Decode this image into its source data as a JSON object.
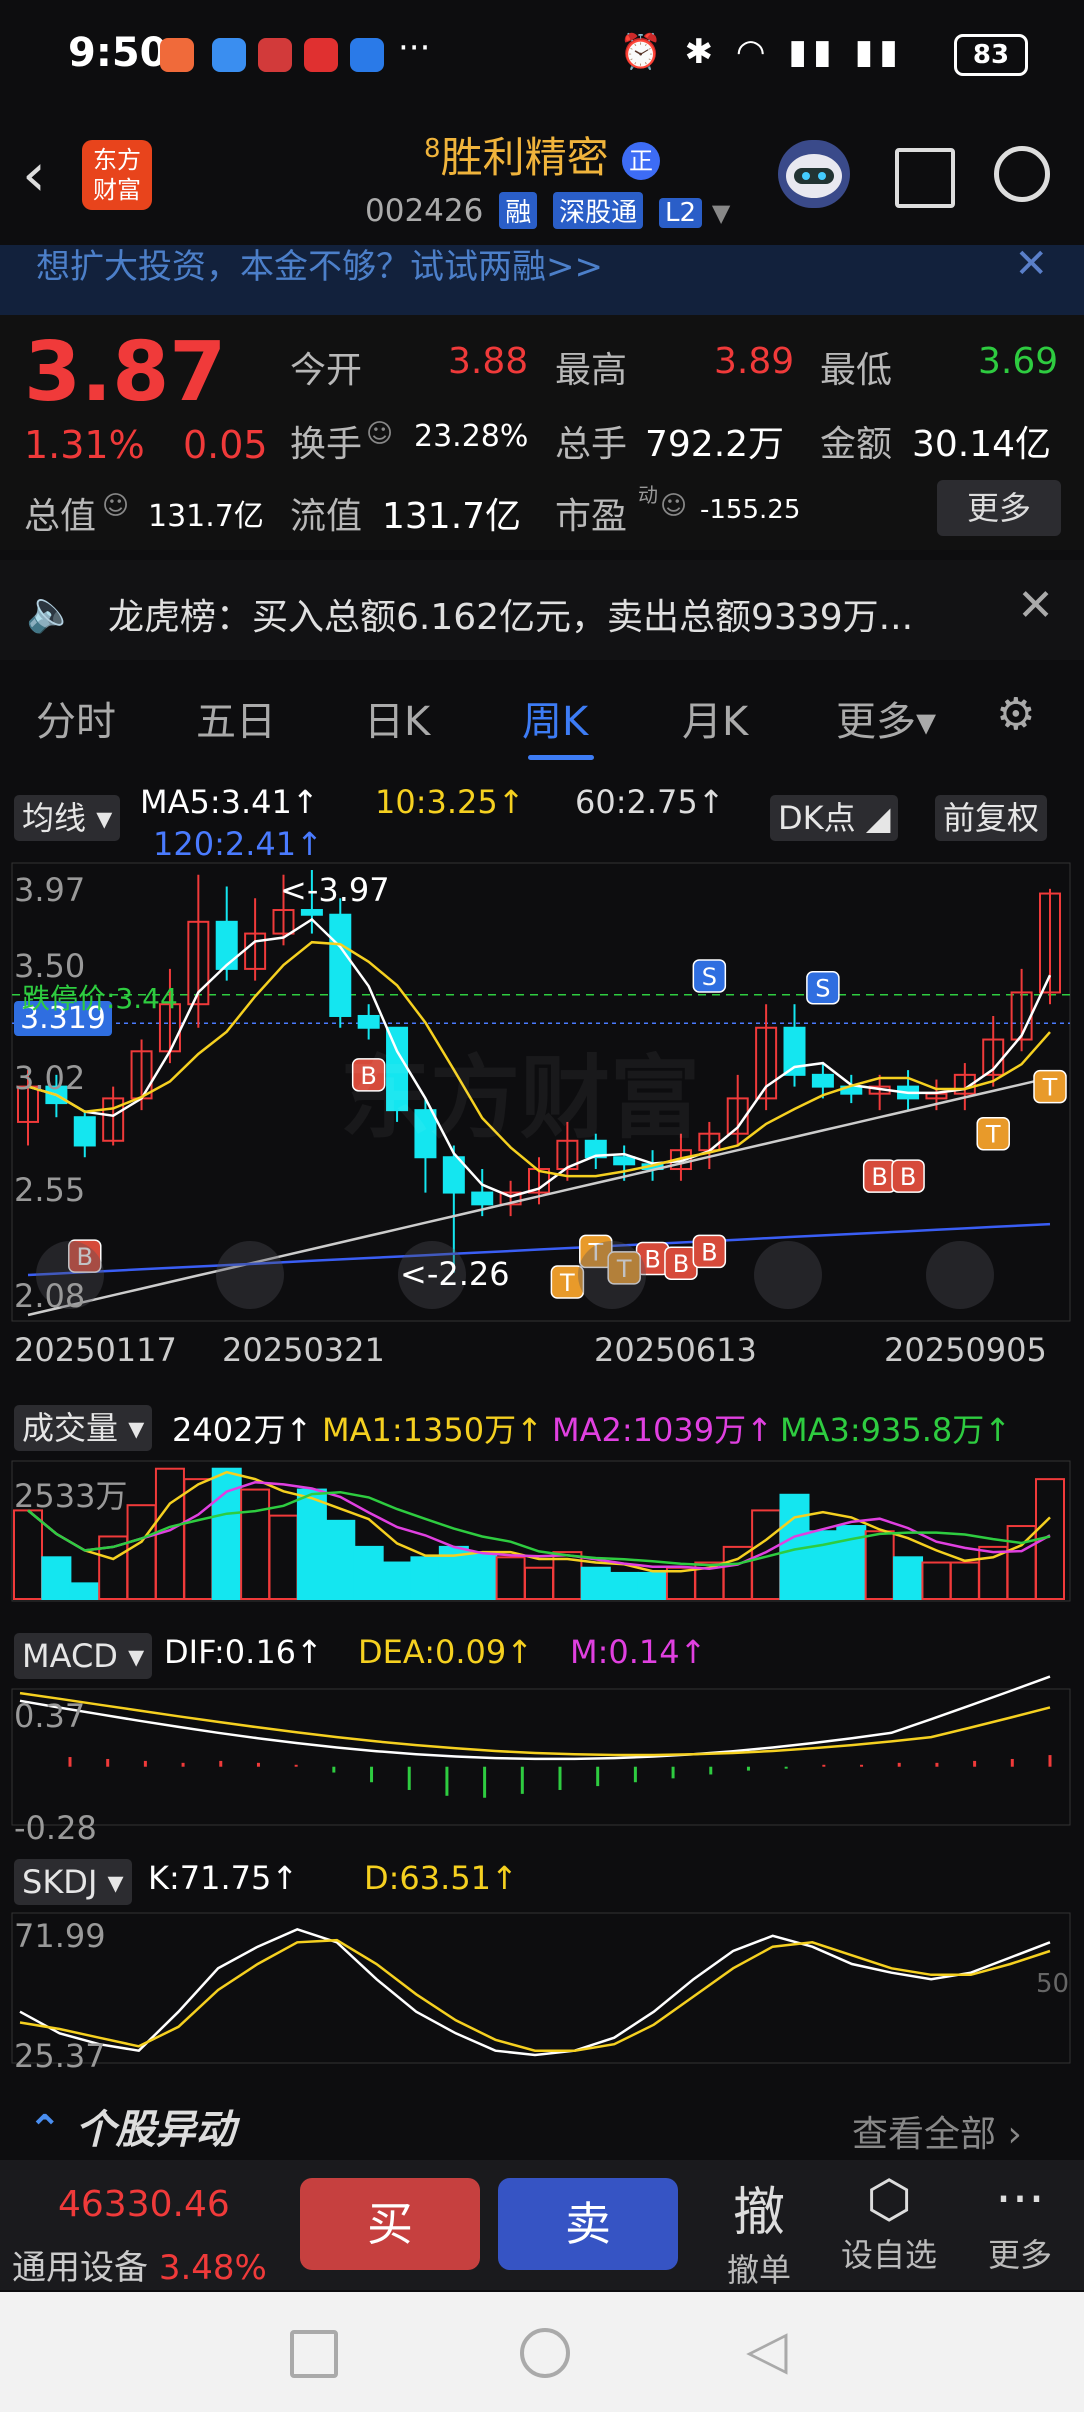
{
  "status_bar": {
    "time": "9:50",
    "dots": "···",
    "battery": "83"
  },
  "header": {
    "back": "‹",
    "logo_line1": "东方",
    "logo_line2": "财富",
    "level": "8",
    "stock_name": "胜利精密",
    "name_badge": "正",
    "stock_code": "002426",
    "tags": [
      "融",
      "深股通",
      "L2"
    ]
  },
  "banner": {
    "text": "想扩大投资，本金不够？试试两融>>",
    "close": "✕"
  },
  "quote": {
    "price": "3.87",
    "change_pct": "1.31%",
    "change": "0.05",
    "open_label": "今开",
    "open": "3.88",
    "high_label": "最高",
    "high": "3.89",
    "low_label": "最低",
    "low": "3.69",
    "turnover_label": "换手",
    "turnover": "23.28%",
    "volume_label": "总手",
    "volume": "792.2万",
    "amount_label": "金额",
    "amount": "30.14亿",
    "mktcap_label": "总值",
    "mktcap": "131.7亿",
    "float_label": "流值",
    "float": "131.7亿",
    "pe_label": "市盈",
    "pe_sup": "动",
    "pe": "-155.25",
    "more": "更多"
  },
  "dragon_tiger": {
    "text": "龙虎榜：买入总额6.162亿元，卖出总额9339万...",
    "close": "✕"
  },
  "tabs": [
    {
      "label": "分时"
    },
    {
      "label": "五日"
    },
    {
      "label": "日K"
    },
    {
      "label": "周K"
    },
    {
      "label": "月K"
    },
    {
      "label": "更多▾"
    }
  ],
  "kline": {
    "indicator_btn": "均线",
    "ma5": "MA5:3.41↑",
    "ma10": "10:3.25↑",
    "ma60": "60:2.75↑",
    "ma120": "120:2.41↑",
    "dk_btn": "DK点",
    "adj_btn": "前复权",
    "y_labels": [
      "3.97",
      "3.50",
      "3.02",
      "2.55",
      "2.08"
    ],
    "current_price_tag": "3.319",
    "limit_label": "跌停价:3.44",
    "high_mark": "<-3.97",
    "low_mark": "<-2.26",
    "x_labels": [
      "20250117",
      "20250321",
      "20250613",
      "20250905"
    ],
    "watermark": "东方财富"
  },
  "volume": {
    "indicator_btn": "成交量",
    "vol": "2402万↑",
    "ma1": "MA1:1350万↑",
    "ma2": "MA2:1039万↑",
    "ma3": "MA3:935.8万↑",
    "y_top": "2533万"
  },
  "macd": {
    "indicator_btn": "MACD",
    "dif": "DIF:0.16↑",
    "dea": "DEA:0.09↑",
    "m": "M:0.14↑",
    "y_top": "0.37",
    "y_bottom": "-0.28"
  },
  "skdj": {
    "indicator_btn": "SKDJ",
    "k": "K:71.75↑",
    "d": "D:63.51↑",
    "y_top": "71.99",
    "y_bottom": "25.37",
    "mid": "50"
  },
  "anomaly": {
    "title": "个股异动",
    "view_all": "查看全部 ›"
  },
  "bottom": {
    "index_value": "46330.46",
    "sector": "通用设备",
    "sector_pct": "3.48%",
    "buy": "买",
    "sell": "卖",
    "cancel_big": "撤",
    "cancel": "撤单",
    "watch": "设自选",
    "more": "更多"
  },
  "chart_data": {
    "type": "candlestick",
    "note_x_labels": [
      "20250117",
      "20250321",
      "20250613",
      "20250905"
    ],
    "y_range": [
      2.08,
      3.97
    ],
    "candles": [
      [
        2.9,
        3.05,
        2.8,
        3.12
      ],
      [
        3.05,
        2.98,
        2.92,
        3.1
      ],
      [
        2.92,
        2.8,
        2.75,
        2.95
      ],
      [
        2.82,
        3.0,
        2.8,
        3.05
      ],
      [
        3.0,
        3.2,
        2.95,
        3.25
      ],
      [
        3.2,
        3.4,
        3.15,
        3.55
      ],
      [
        3.4,
        3.75,
        3.3,
        3.95
      ],
      [
        3.75,
        3.55,
        3.5,
        3.9
      ],
      [
        3.55,
        3.7,
        3.5,
        3.85
      ],
      [
        3.7,
        3.8,
        3.65,
        3.95
      ],
      [
        3.8,
        3.78,
        3.7,
        3.97
      ],
      [
        3.78,
        3.35,
        3.3,
        3.85
      ],
      [
        3.35,
        3.3,
        3.25,
        3.4
      ],
      [
        3.3,
        2.95,
        2.9,
        3.3
      ],
      [
        2.95,
        2.75,
        2.6,
        3.0
      ],
      [
        2.75,
        2.6,
        2.26,
        2.8
      ],
      [
        2.6,
        2.55,
        2.5,
        2.7
      ],
      [
        2.55,
        2.6,
        2.5,
        2.65
      ],
      [
        2.6,
        2.7,
        2.55,
        2.75
      ],
      [
        2.7,
        2.82,
        2.65,
        2.9
      ],
      [
        2.82,
        2.75,
        2.7,
        2.85
      ],
      [
        2.75,
        2.72,
        2.65,
        2.8
      ],
      [
        2.72,
        2.7,
        2.65,
        2.78
      ],
      [
        2.7,
        2.78,
        2.65,
        2.85
      ],
      [
        2.78,
        2.85,
        2.7,
        2.9
      ],
      [
        2.85,
        3.0,
        2.8,
        3.1
      ],
      [
        3.0,
        3.3,
        2.95,
        3.4
      ],
      [
        3.3,
        3.1,
        3.05,
        3.4
      ],
      [
        3.1,
        3.05,
        3.0,
        3.15
      ],
      [
        3.05,
        3.02,
        2.98,
        3.1
      ],
      [
        3.02,
        3.05,
        2.95,
        3.1
      ],
      [
        3.05,
        3.0,
        2.95,
        3.12
      ],
      [
        3.0,
        3.02,
        2.95,
        3.08
      ],
      [
        3.02,
        3.1,
        2.95,
        3.15
      ],
      [
        3.1,
        3.25,
        3.05,
        3.35
      ],
      [
        3.25,
        3.45,
        3.2,
        3.55
      ],
      [
        3.45,
        3.87,
        3.4,
        3.89
      ]
    ],
    "volumes": [
      17,
      8,
      3,
      12,
      18,
      25,
      23,
      25,
      21,
      16,
      21,
      15,
      10,
      7,
      8,
      10,
      9,
      8,
      6,
      9,
      6,
      5,
      5,
      6,
      7,
      10,
      17,
      20,
      13,
      14,
      13,
      8,
      7,
      7,
      10,
      14,
      23
    ],
    "macd_bars": [
      0.05,
      0.04,
      0.03,
      0.02,
      0.03,
      0.02,
      0.01,
      -0.03,
      -0.08,
      -0.12,
      -0.15,
      -0.16,
      -0.14,
      -0.12,
      -0.1,
      -0.08,
      -0.06,
      -0.04,
      -0.02,
      -0.01,
      0.01,
      0.01,
      0.02,
      0.02,
      0.03,
      0.04,
      0.06
    ]
  }
}
